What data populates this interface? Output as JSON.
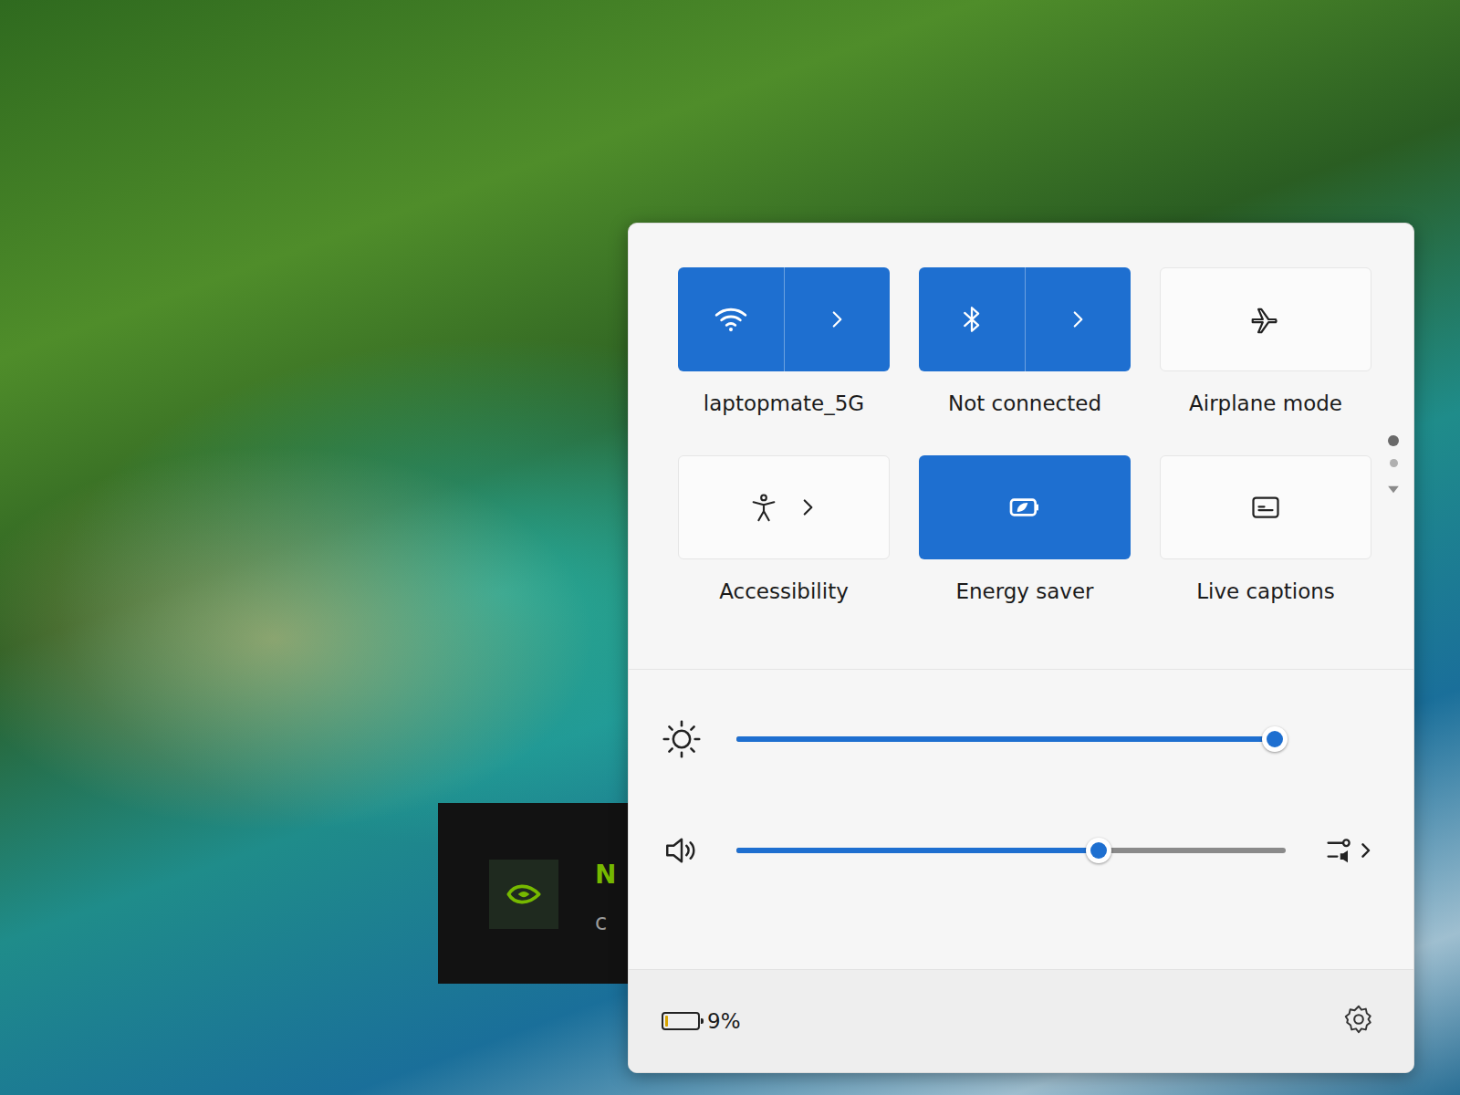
{
  "notification": {
    "title": "N",
    "body": "c"
  },
  "quick_settings": {
    "tiles": [
      {
        "label": "laptopmate_5G",
        "kind": "split",
        "on": true
      },
      {
        "label": "Not connected",
        "kind": "split",
        "on": true
      },
      {
        "label": "Airplane mode",
        "kind": "plain",
        "on": false
      },
      {
        "label": "Accessibility",
        "kind": "expand",
        "on": false
      },
      {
        "label": "Energy saver",
        "kind": "plain",
        "on": true
      },
      {
        "label": "Live captions",
        "kind": "plain",
        "on": false
      }
    ],
    "pages": [
      {
        "selected": true
      },
      {
        "selected": false
      }
    ],
    "sliders": [
      {
        "name": "brightness",
        "level": 0.98
      },
      {
        "name": "volume",
        "level": 0.66
      }
    ],
    "battery": {
      "reading": "9%",
      "level": 0.09
    }
  }
}
